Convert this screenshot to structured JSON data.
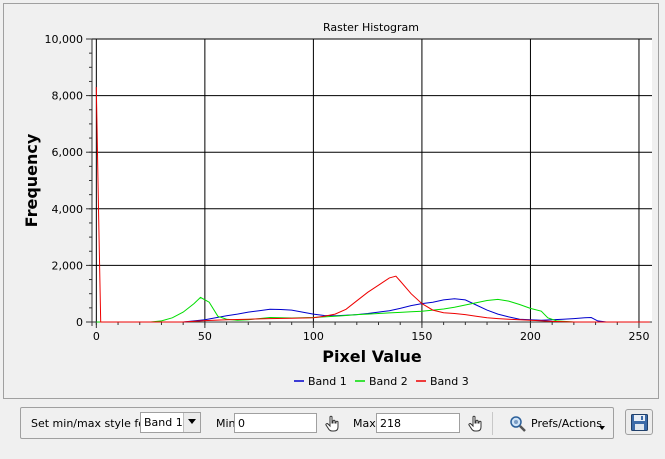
{
  "chart_data": {
    "type": "line",
    "title": "Raster Histogram",
    "xlabel": "Pixel Value",
    "ylabel": "Frequency",
    "xlim": [
      -2,
      256
    ],
    "ylim": [
      0,
      10000
    ],
    "x_ticks": [
      0,
      50,
      100,
      150,
      200,
      250
    ],
    "x_tick_labels": [
      "0",
      "50",
      "100",
      "150",
      "200",
      "250"
    ],
    "y_ticks": [
      0,
      2000,
      4000,
      6000,
      8000,
      10000
    ],
    "y_tick_labels": [
      "0",
      "2,000",
      "4,000",
      "6,000",
      "8,000",
      "10,000"
    ],
    "grid": true,
    "legend": "bottom-center",
    "series": [
      {
        "name": "Band 1",
        "color": "#0000cc",
        "points": [
          [
            0,
            0
          ],
          [
            40,
            0
          ],
          [
            45,
            40
          ],
          [
            50,
            80
          ],
          [
            55,
            150
          ],
          [
            60,
            220
          ],
          [
            65,
            280
          ],
          [
            70,
            350
          ],
          [
            75,
            400
          ],
          [
            80,
            450
          ],
          [
            85,
            440
          ],
          [
            90,
            420
          ],
          [
            95,
            350
          ],
          [
            100,
            280
          ],
          [
            105,
            230
          ],
          [
            110,
            220
          ],
          [
            115,
            240
          ],
          [
            120,
            260
          ],
          [
            125,
            300
          ],
          [
            130,
            350
          ],
          [
            135,
            400
          ],
          [
            140,
            480
          ],
          [
            145,
            580
          ],
          [
            150,
            650
          ],
          [
            155,
            700
          ],
          [
            160,
            780
          ],
          [
            165,
            820
          ],
          [
            170,
            780
          ],
          [
            175,
            600
          ],
          [
            180,
            420
          ],
          [
            185,
            280
          ],
          [
            190,
            180
          ],
          [
            195,
            100
          ],
          [
            200,
            80
          ],
          [
            205,
            60
          ],
          [
            210,
            80
          ],
          [
            215,
            100
          ],
          [
            220,
            120
          ],
          [
            225,
            150
          ],
          [
            228,
            160
          ],
          [
            231,
            40
          ],
          [
            235,
            0
          ],
          [
            255,
            0
          ]
        ]
      },
      {
        "name": "Band 2",
        "color": "#00dd00",
        "points": [
          [
            0,
            0
          ],
          [
            25,
            0
          ],
          [
            30,
            40
          ],
          [
            35,
            150
          ],
          [
            40,
            350
          ],
          [
            45,
            650
          ],
          [
            48,
            870
          ],
          [
            52,
            700
          ],
          [
            56,
            200
          ],
          [
            60,
            100
          ],
          [
            65,
            60
          ],
          [
            70,
            80
          ],
          [
            75,
            120
          ],
          [
            80,
            160
          ],
          [
            85,
            150
          ],
          [
            90,
            140
          ],
          [
            95,
            150
          ],
          [
            100,
            160
          ],
          [
            105,
            180
          ],
          [
            110,
            200
          ],
          [
            115,
            230
          ],
          [
            120,
            260
          ],
          [
            125,
            280
          ],
          [
            130,
            300
          ],
          [
            135,
            320
          ],
          [
            140,
            340
          ],
          [
            145,
            360
          ],
          [
            150,
            380
          ],
          [
            155,
            420
          ],
          [
            160,
            460
          ],
          [
            165,
            520
          ],
          [
            170,
            600
          ],
          [
            175,
            680
          ],
          [
            180,
            760
          ],
          [
            185,
            800
          ],
          [
            190,
            740
          ],
          [
            195,
            620
          ],
          [
            200,
            480
          ],
          [
            205,
            380
          ],
          [
            208,
            150
          ],
          [
            212,
            40
          ],
          [
            220,
            0
          ],
          [
            255,
            0
          ]
        ]
      },
      {
        "name": "Band 3",
        "color": "#ee0000",
        "points": [
          [
            0,
            8300
          ],
          [
            1,
            4000
          ],
          [
            2,
            0
          ],
          [
            40,
            0
          ],
          [
            50,
            50
          ],
          [
            60,
            80
          ],
          [
            70,
            100
          ],
          [
            80,
            120
          ],
          [
            90,
            130
          ],
          [
            100,
            150
          ],
          [
            105,
            200
          ],
          [
            110,
            280
          ],
          [
            115,
            450
          ],
          [
            120,
            750
          ],
          [
            125,
            1050
          ],
          [
            130,
            1300
          ],
          [
            135,
            1560
          ],
          [
            138,
            1620
          ],
          [
            140,
            1450
          ],
          [
            145,
            1000
          ],
          [
            150,
            650
          ],
          [
            155,
            420
          ],
          [
            160,
            330
          ],
          [
            165,
            300
          ],
          [
            170,
            260
          ],
          [
            175,
            200
          ],
          [
            180,
            150
          ],
          [
            185,
            120
          ],
          [
            190,
            100
          ],
          [
            200,
            60
          ],
          [
            210,
            20
          ],
          [
            220,
            0
          ],
          [
            255,
            0
          ]
        ]
      }
    ]
  },
  "toolbar": {
    "minmax_label": "Set min/max style for",
    "band_select": "Band 1",
    "min_label": "Min",
    "min_value": "0",
    "max_label": "Max",
    "max_value": "218",
    "prefs_label": "Prefs/Actions"
  },
  "icons": {
    "picker": "hand-pointer-icon",
    "prefs": "magnifier-gear-icon",
    "save": "floppy-disk-icon"
  }
}
